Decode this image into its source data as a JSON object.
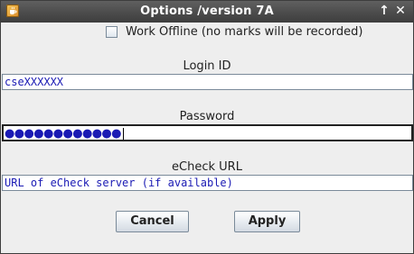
{
  "window": {
    "title": "Options /version 7A",
    "icons": {
      "app": "java-cup-icon",
      "maximize": "arrow-up-icon",
      "close": "close-icon"
    }
  },
  "offline": {
    "label": "Work Offline (no marks will be recorded)",
    "checked": false
  },
  "login": {
    "label": "Login ID",
    "value": "cseXXXXXX"
  },
  "password": {
    "label": "Password",
    "masked_value": "●●●●●●●●●●●●"
  },
  "echeck": {
    "label": "eCheck URL",
    "value": "URL of eCheck server (if available)"
  },
  "buttons": {
    "cancel": "Cancel",
    "apply": "Apply"
  },
  "colors": {
    "title_bar": "#4a4a4a",
    "field_text": "#1a1ab4",
    "background": "#eeeeee"
  }
}
